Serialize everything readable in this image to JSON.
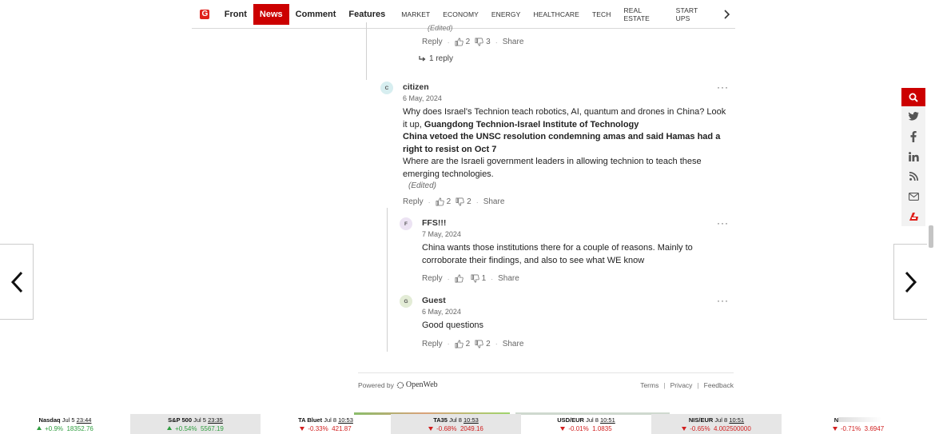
{
  "nav": {
    "logo_text": "G",
    "main": [
      "Front",
      "News",
      "Comment",
      "Features"
    ],
    "active_index": 1,
    "sections": [
      "MARKET",
      "ECONOMY",
      "ENERGY",
      "HEALTHCARE",
      "TECH",
      "REAL ESTATE",
      "START UPS"
    ]
  },
  "top_comment": {
    "edited": "(Edited)",
    "reply": "Reply",
    "likes": "2",
    "dislikes": "3",
    "share": "Share",
    "replies_link": "1 reply"
  },
  "comments": [
    {
      "avatar": "C",
      "author": "citizen",
      "date": "6 May, 2024",
      "body_1": "Why does Israel's Technion teach robotics, AI, quantum and drones in China? Look it up, ",
      "body_bold_1": "Guangdong Technion-Israel Institute of Technology",
      "body_bold_2": "China vetoed the UNSC resolution condemning amas and said Hamas had a right to resist on Oct 7",
      "body_2": "Where are the Israeli government leaders in allowing technion to teach these emerging technologies.",
      "edited": "(Edited)",
      "reply": "Reply",
      "likes": "2",
      "dislikes": "2",
      "share": "Share"
    },
    {
      "avatar": "F",
      "author": "FFS!!!",
      "date": "7 May, 2024",
      "body": "China wants those institutions there for a couple of reasons. Mainly to corroborate their findings, and also to see what WE know",
      "reply": "Reply",
      "likes": "",
      "dislikes": "1",
      "share": "Share"
    },
    {
      "avatar": "G",
      "author": "Guest",
      "date": "6 May, 2024",
      "body": "Good questions",
      "reply": "Reply",
      "likes": "2",
      "dislikes": "2",
      "share": "Share"
    }
  ],
  "footer": {
    "powered_by": "Powered by",
    "brand": "OpenWeb",
    "terms": "Terms",
    "privacy": "Privacy",
    "feedback": "Feedback"
  },
  "ticker": [
    {
      "name": "Nasdaq",
      "date": "Jul 5",
      "time": "23:44",
      "change": "+0.9%",
      "value": "18352.76",
      "dir": "up"
    },
    {
      "name": "S&P 500",
      "date": "Jul 5",
      "time": "23:35",
      "change": "+0.54%",
      "value": "5567.19",
      "dir": "up"
    },
    {
      "name": "TA Bluet",
      "date": "Jul 8",
      "time": "10:53",
      "change": "-0.33%",
      "value": "421.87",
      "dir": "down"
    },
    {
      "name": "TA35",
      "date": "Jul 8",
      "time": "10:53",
      "change": "-0.68%",
      "value": "2049.16",
      "dir": "down"
    },
    {
      "name": "USD/EUR",
      "date": "Jul 8",
      "time": "10:51",
      "change": "-0.01%",
      "value": "1.0835",
      "dir": "down"
    },
    {
      "name": "NIS/EUR",
      "date": "Jul 8",
      "time": "10:51",
      "change": "-0.65%",
      "value": "4.002500000",
      "dir": "down"
    },
    {
      "name": "N",
      "date": "",
      "time": "",
      "change": "-0.71%",
      "value": "3.6947",
      "dir": "down"
    }
  ],
  "colors": {
    "accent": "#cc0000",
    "up": "#2f9e3f",
    "down": "#d12020",
    "avatar_c": "#d7eef0",
    "avatar_f": "#ece3f3",
    "avatar_g": "#e3ecd6"
  }
}
